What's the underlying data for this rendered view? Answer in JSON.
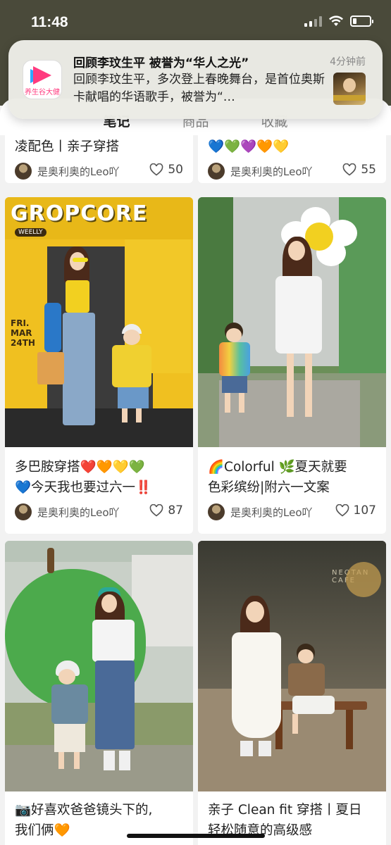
{
  "status_bar": {
    "time": "11:48"
  },
  "notification": {
    "title": "回顾李玟生平 被誉为“华人之光”",
    "time": "4分钟前",
    "body": "回顾李玟生平，多次登上春晚舞台，是首位奥斯卡献唱的华语歌手，被誉为“…",
    "app_icon": "video-app-icon",
    "app_label": "养生谷大健"
  },
  "tabs": [
    {
      "label": "笔记",
      "active": true
    },
    {
      "label": "商品",
      "active": false
    },
    {
      "label": "收藏",
      "active": false
    }
  ],
  "feed": {
    "left": [
      {
        "title_partial": "凌配色丨亲子穿搭",
        "author": "是奥利奥的Leo吖",
        "likes": "50"
      },
      {
        "image_text": "GROPCORE",
        "image_subtext": "FRI. MAR 24TH",
        "image_brand": "WEELLY",
        "title": "多巴胺穿搭❤️🧡💛💚\n💙今天我也要过六一‼️",
        "author": "是奥利奥的Leo吖",
        "likes": "87"
      },
      {
        "title": "📷好喜欢爸爸镜头下的,\n我们俩🧡",
        "author": "",
        "likes": ""
      }
    ],
    "right": [
      {
        "title_partial": "💙💚💜🧡💛",
        "author": "是奥利奥的Leo吖",
        "likes": "55"
      },
      {
        "title": "🌈Colorful 🌿夏天就要\n色彩缤纷|附六一文案",
        "author": "是奥利奥的Leo吖",
        "likes": "107"
      },
      {
        "image_text": "NEOTAN CAFE",
        "title": "亲子 Clean fit 穿搭丨夏日\n轻松随意的高级感",
        "author": "",
        "likes": ""
      }
    ]
  },
  "colors": {
    "accent": "#ff2442",
    "background": "#f2f2f2"
  }
}
